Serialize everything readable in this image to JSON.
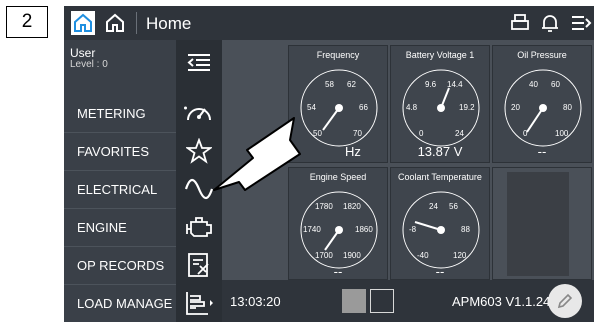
{
  "step_number": "2",
  "header": {
    "title": "Home"
  },
  "user": {
    "name": "User",
    "level": "Level : 0"
  },
  "menu": [
    {
      "label": "METERING",
      "icon": "speedometer-icon"
    },
    {
      "label": "FAVORITES",
      "icon": "star-icon"
    },
    {
      "label": "ELECTRICAL",
      "icon": "sine-wave-icon"
    },
    {
      "label": "ENGINE",
      "icon": "engine-icon"
    },
    {
      "label": "OP RECORDS",
      "icon": "records-icon"
    },
    {
      "label": "LOAD MANAGE",
      "icon": "bar-chart-icon"
    }
  ],
  "gauges": [
    {
      "title": "Frequency",
      "value": "Hz",
      "ticks": [
        "58",
        "62",
        "54",
        "66",
        "50",
        "70"
      ]
    },
    {
      "title": "Battery Voltage 1",
      "value": "13.87 V",
      "ticks": [
        "9.6",
        "14.4",
        "4.8",
        "19.2",
        "0",
        "24"
      ]
    },
    {
      "title": "Oil Pressure",
      "value": "--",
      "ticks": [
        "40",
        "60",
        "20",
        "80",
        "0",
        "100"
      ]
    },
    {
      "title": "Engine Speed",
      "value": "--",
      "ticks": [
        "1780",
        "1820",
        "1740",
        "1860",
        "1700",
        "1900"
      ]
    },
    {
      "title": "Coolant Temperature",
      "value": "--",
      "ticks": [
        "24",
        "56",
        "-8",
        "88",
        "-40",
        "120"
      ]
    }
  ],
  "footer": {
    "time": "13:03:20",
    "version": "APM603 V1.1.24"
  },
  "colors": {
    "accent": "#1f8fe0",
    "background": "#3a4048",
    "arrow": "#ffffff"
  }
}
